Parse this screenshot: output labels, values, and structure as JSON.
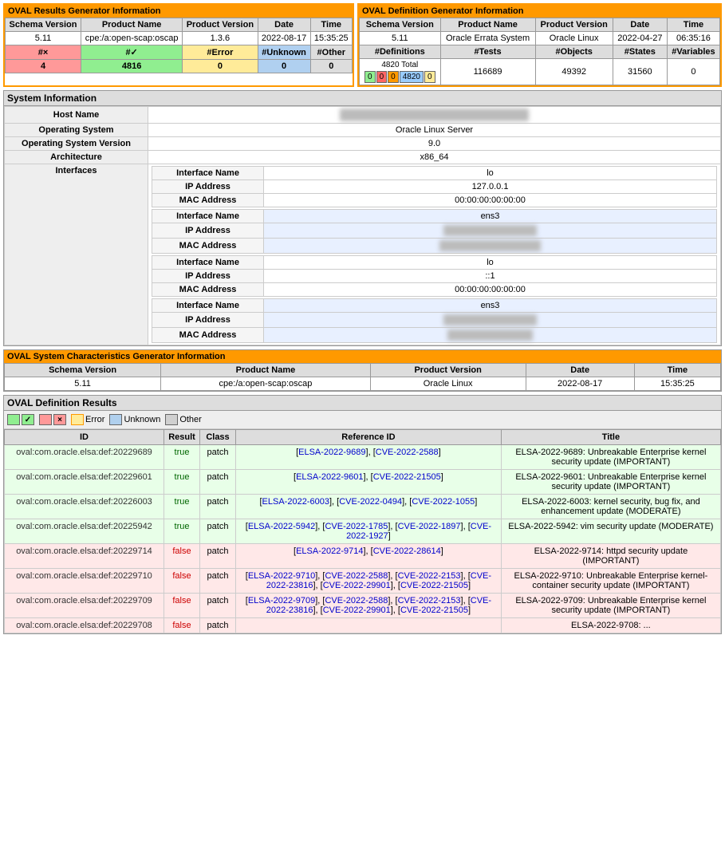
{
  "oval_results_panel": {
    "title": "OVAL Results Generator Information",
    "headers": [
      "Schema Version",
      "Product Name",
      "Product Version",
      "Date",
      "Time"
    ],
    "row": [
      "5.11",
      "cpe:/a:open-scap:oscap",
      "1.3.6",
      "2022-08-17",
      "15:35:25"
    ],
    "count_headers": [
      "#×",
      "#✓",
      "#Error",
      "#Unknown",
      "#Other"
    ],
    "count_values": [
      "4",
      "4816",
      "0",
      "0",
      "0"
    ]
  },
  "oval_definition_panel": {
    "title": "OVAL Definition Generator Information",
    "headers": [
      "Schema Version",
      "Product Name",
      "Product Version",
      "Date",
      "Time"
    ],
    "row": [
      "5.11",
      "Oracle Errata System",
      "Oracle Linux",
      "2022-04-27",
      "06:35:16"
    ],
    "def_headers": [
      "#Definitions",
      "#Tests",
      "#Objects",
      "#States",
      "#Variables"
    ],
    "def_total": "4820 Total",
    "def_counts_colored": [
      "0",
      "0",
      "0",
      "4820",
      "0"
    ],
    "def_count_colors": [
      "green",
      "red",
      "orange",
      "blue",
      "yellow"
    ],
    "tests_val": "116689",
    "objects_val": "49392",
    "states_val": "31560",
    "variables_val": "0"
  },
  "system_info": {
    "title": "System Information",
    "host_name_label": "Host Name",
    "host_name_value": "REDACTED",
    "os_label": "Operating System",
    "os_value": "Oracle Linux Server",
    "os_version_label": "Operating System Version",
    "os_version_value": "9.0",
    "arch_label": "Architecture",
    "arch_value": "x86_64",
    "interfaces_label": "Interfaces",
    "interfaces": [
      {
        "name": "lo",
        "ip": "127.0.0.1",
        "mac": "00:00:00:00:00:00",
        "ip_redacted": false,
        "mac_redacted": false
      },
      {
        "name": "ens3",
        "ip": "REDACTED",
        "mac": "REDACTED",
        "ip_redacted": true,
        "mac_redacted": true
      },
      {
        "name": "lo",
        "ip": "::1",
        "mac": "00:00:00:00:00:00",
        "ip_redacted": false,
        "mac_redacted": false
      },
      {
        "name": "ens3",
        "ip": "REDACTED",
        "mac": "REDACTED",
        "ip_redacted": true,
        "mac_redacted": true
      }
    ]
  },
  "oval_sys_char": {
    "title": "OVAL System Characteristics Generator Information",
    "headers": [
      "Schema Version",
      "Product Name",
      "Product Version",
      "Date",
      "Time"
    ],
    "row": [
      "5.11",
      "cpe:/a:open-scap:oscap",
      "Oracle Linux",
      "2022-08-17",
      "15:35:25"
    ]
  },
  "oval_def_results": {
    "title": "OVAL Definition Results",
    "legend": {
      "true_label": "",
      "false_label": "",
      "error_label": "Error",
      "unknown_label": "Unknown",
      "other_label": "Other"
    },
    "col_headers": [
      "ID",
      "Result",
      "Class",
      "Reference ID",
      "Title"
    ],
    "rows": [
      {
        "id": "oval:com.oracle.elsa:def:20229689",
        "result": "true",
        "class": "patch",
        "refs": [
          {
            "id": "ELSA-2022-9689",
            "href": "#"
          },
          {
            "id": "CVE-2022-2588",
            "href": "#"
          }
        ],
        "ref_text": "[ELSA-2022-9689], [CVE-2022-2588]",
        "title": "ELSA-2022-9689: Unbreakable Enterprise kernel security update (IMPORTANT)"
      },
      {
        "id": "oval:com.oracle.elsa:def:20229601",
        "result": "true",
        "class": "patch",
        "refs": [
          {
            "id": "ELSA-2022-9601",
            "href": "#"
          },
          {
            "id": "CVE-2022-21505",
            "href": "#"
          }
        ],
        "ref_text": "[ELSA-2022-9601], [CVE-2022-21505]",
        "title": "ELSA-2022-9601: Unbreakable Enterprise kernel security update (IMPORTANT)"
      },
      {
        "id": "oval:com.oracle.elsa:def:20226003",
        "result": "true",
        "class": "patch",
        "refs": [
          {
            "id": "ELSA-2022-6003",
            "href": "#"
          },
          {
            "id": "CVE-2022-0494",
            "href": "#"
          },
          {
            "id": "CVE-2022-1055",
            "href": "#"
          }
        ],
        "ref_text": "[ELSA-2022-6003], [CVE-2022-0494], [CVE-2022-1055]",
        "title": "ELSA-2022-6003: kernel security, bug fix, and enhancement update (MODERATE)"
      },
      {
        "id": "oval:com.oracle.elsa:def:20225942",
        "result": "true",
        "class": "patch",
        "refs": [
          {
            "id": "ELSA-2022-5942",
            "href": "#"
          },
          {
            "id": "CVE-2022-1785",
            "href": "#"
          },
          {
            "id": "CVE-2022-1897",
            "href": "#"
          },
          {
            "id": "CVE-2022-1927",
            "href": "#"
          }
        ],
        "ref_text": "[ELSA-2022-5942], [CVE-2022-1785], [CVE-2022-1897], [CVE-2022-1927]",
        "title": "ELSA-2022-5942: vim security update (MODERATE)"
      },
      {
        "id": "oval:com.oracle.elsa:def:20229714",
        "result": "false",
        "class": "patch",
        "refs": [
          {
            "id": "ELSA-2022-9714",
            "href": "#"
          },
          {
            "id": "CVE-2022-28614",
            "href": "#"
          }
        ],
        "ref_text": "[ELSA-2022-9714], [CVE-2022-28614]",
        "title": "ELSA-2022-9714: httpd security update (IMPORTANT)"
      },
      {
        "id": "oval:com.oracle.elsa:def:20229710",
        "result": "false",
        "class": "patch",
        "refs": [
          {
            "id": "ELSA-2022-9710",
            "href": "#"
          },
          {
            "id": "CVE-2022-2588",
            "href": "#"
          },
          {
            "id": "CVE-2022-2153",
            "href": "#"
          },
          {
            "id": "CVE-2022-23816",
            "href": "#"
          },
          {
            "id": "CVE-2022-29901",
            "href": "#"
          },
          {
            "id": "CVE-2022-21505",
            "href": "#"
          }
        ],
        "ref_text": "[ELSA-2022-9710], [CVE-2022-2588], [CVE-2022-2153], [CVE-2022-23816], [CVE-2022-29901], [CVE-2022-21505]",
        "title": "ELSA-2022-9710: Unbreakable Enterprise kernel-container security update (IMPORTANT)"
      },
      {
        "id": "oval:com.oracle.elsa:def:20229709",
        "result": "false",
        "class": "patch",
        "refs": [
          {
            "id": "ELSA-2022-9709",
            "href": "#"
          },
          {
            "id": "CVE-2022-2588",
            "href": "#"
          },
          {
            "id": "CVE-2022-2153",
            "href": "#"
          },
          {
            "id": "CVE-2022-23816",
            "href": "#"
          },
          {
            "id": "CVE-2022-29901",
            "href": "#"
          },
          {
            "id": "CVE-2022-21505",
            "href": "#"
          }
        ],
        "ref_text": "[ELSA-2022-9709], [CVE-2022-2588], [CVE-2022-2153], [CVE-2022-23816], [CVE-2022-29901], [CVE-2022-21505]",
        "title": "ELSA-2022-9709: Unbreakable Enterprise kernel security update (IMPORTANT)"
      },
      {
        "id": "oval:com.oracle.elsa:def:20229708",
        "result": "false",
        "class": "patch",
        "refs": [],
        "ref_text": "",
        "title": "ELSA-2022-9708: ..."
      }
    ]
  }
}
